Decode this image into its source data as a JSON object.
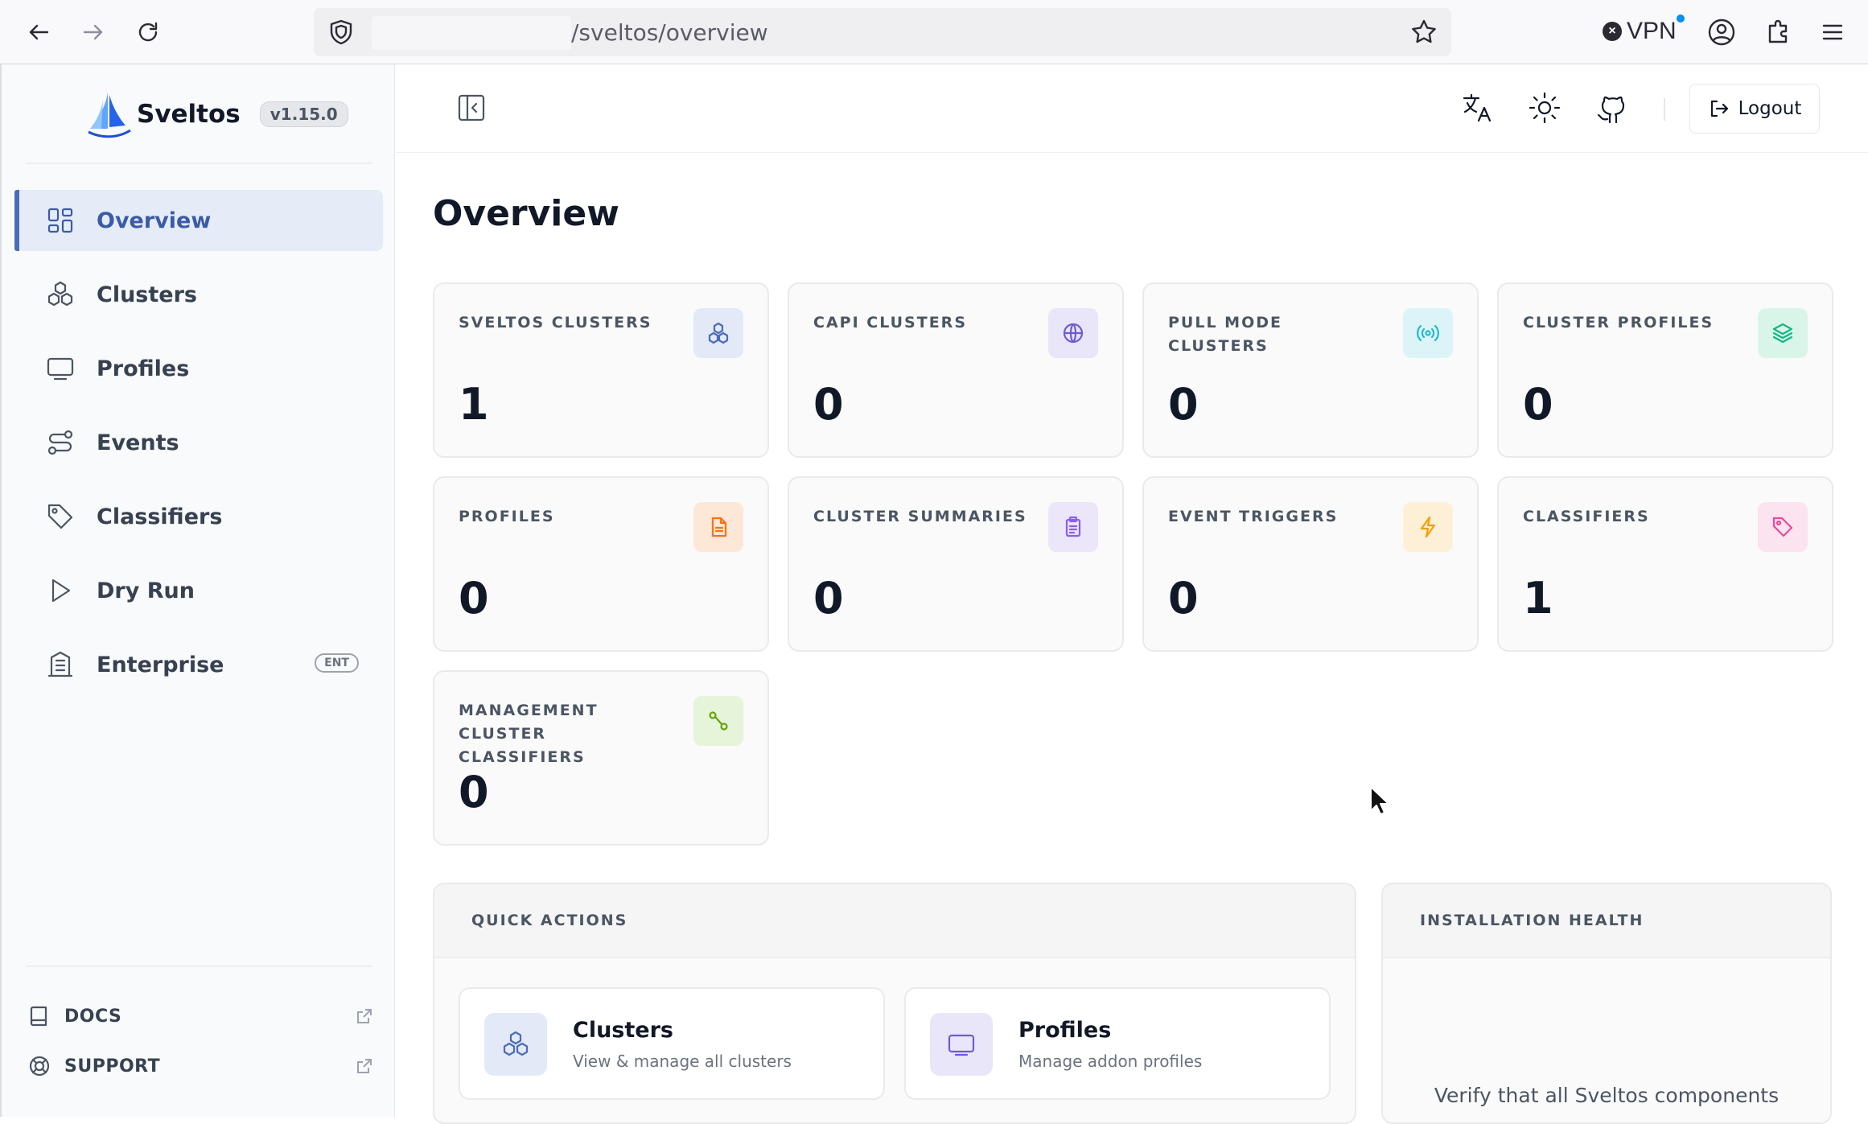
{
  "browser": {
    "url": "/sveltos/overview",
    "vpn_label": "VPN"
  },
  "brand": {
    "name": "Sveltos",
    "version": "v1.15.0"
  },
  "sidebar": {
    "items": [
      {
        "label": "Overview",
        "icon": "grid-icon",
        "active": true
      },
      {
        "label": "Clusters",
        "icon": "cluster-icon"
      },
      {
        "label": "Profiles",
        "icon": "monitor-icon"
      },
      {
        "label": "Events",
        "icon": "route-icon"
      },
      {
        "label": "Classifiers",
        "icon": "tag-icon"
      },
      {
        "label": "Dry Run",
        "icon": "play-icon"
      },
      {
        "label": "Enterprise",
        "icon": "building-icon",
        "badge": "ENT"
      }
    ],
    "bottom": [
      {
        "label": "DOCS",
        "icon": "book-icon"
      },
      {
        "label": "SUPPORT",
        "icon": "lifebuoy-icon"
      }
    ]
  },
  "topbar": {
    "logout_label": "Logout"
  },
  "main": {
    "title": "Overview",
    "cards": [
      {
        "label": "SVELTOS CLUSTERS",
        "value": "1",
        "icon": "cluster-icon",
        "color": "#4b6cb7",
        "bg": "#e3e9f6"
      },
      {
        "label": "CAPI CLUSTERS",
        "value": "0",
        "icon": "globe-icon",
        "color": "#6d5bd0",
        "bg": "#e9e6f9"
      },
      {
        "label": "PULL MODE CLUSTERS",
        "value": "0",
        "icon": "broadcast-icon",
        "color": "#22b8cf",
        "bg": "#dcf4f8"
      },
      {
        "label": "CLUSTER PROFILES",
        "value": "0",
        "icon": "layers-icon",
        "color": "#10b981",
        "bg": "#d9f5ea"
      },
      {
        "label": "PROFILES",
        "value": "0",
        "icon": "file-icon",
        "color": "#f97316",
        "bg": "#fde7d7"
      },
      {
        "label": "CLUSTER SUMMARIES",
        "value": "0",
        "icon": "clipboard-icon",
        "color": "#8b5cf6",
        "bg": "#ece6fb"
      },
      {
        "label": "EVENT TRIGGERS",
        "value": "0",
        "icon": "bolt-icon",
        "color": "#f59e0b",
        "bg": "#fdf0d7"
      },
      {
        "label": "CLASSIFIERS",
        "value": "1",
        "icon": "tag-icon",
        "color": "#ec4899",
        "bg": "#fbe3ef"
      },
      {
        "label": "MANAGEMENT CLUSTER CLASSIFIERS",
        "value": "0",
        "icon": "route-icon",
        "color": "#65a30d",
        "bg": "#e6f4d9"
      }
    ],
    "quick_actions": {
      "title": "QUICK ACTIONS",
      "items": [
        {
          "title": "Clusters",
          "subtitle": "View & manage all clusters",
          "icon": "cluster-icon",
          "color": "#4b6cb7",
          "bg": "#e3e9f6"
        },
        {
          "title": "Profiles",
          "subtitle": "Manage addon profiles",
          "icon": "monitor-icon",
          "color": "#6d5bd0",
          "bg": "#e9e6f9"
        }
      ]
    },
    "installation_health": {
      "title": "INSTALLATION HEALTH",
      "text": "Verify that all Sveltos components"
    }
  }
}
